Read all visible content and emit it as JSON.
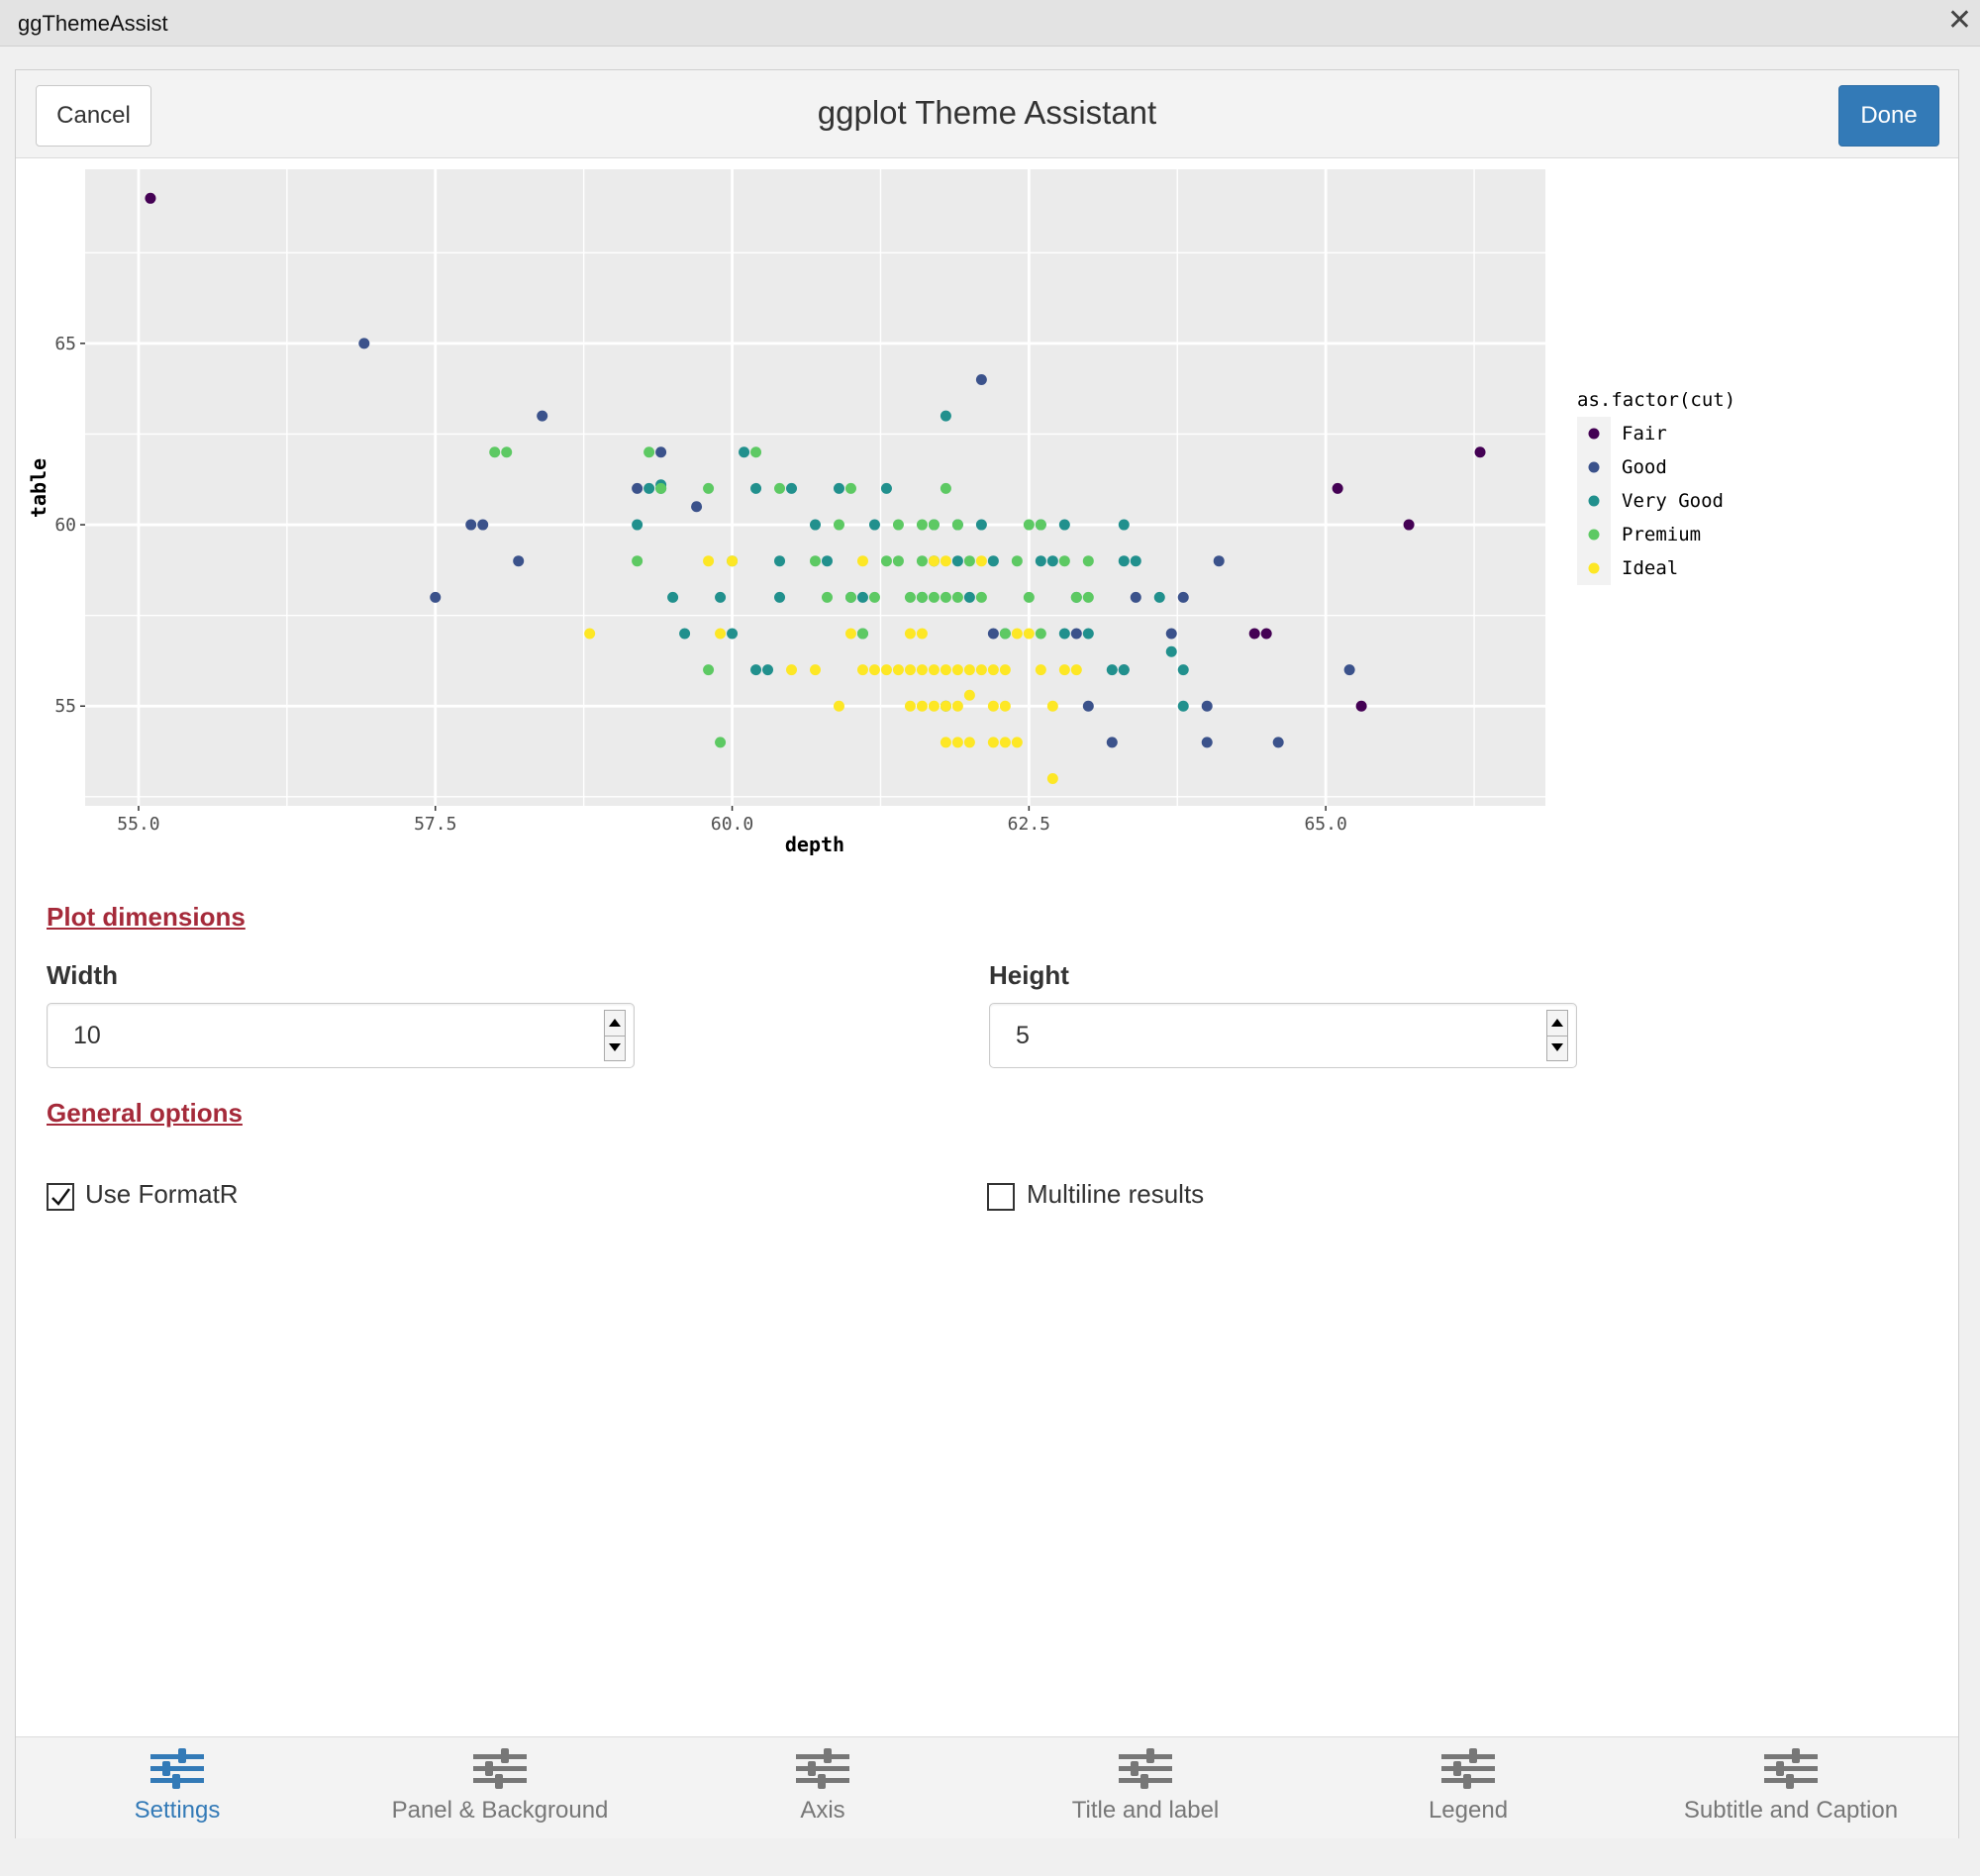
{
  "window": {
    "title": "ggThemeAssist",
    "close_glyph": "✕"
  },
  "header": {
    "cancel_label": "Cancel",
    "title": "ggplot Theme Assistant",
    "done_label": "Done"
  },
  "chart_data": {
    "type": "scatter",
    "xlabel": "depth",
    "ylabel": "table",
    "xlim": [
      54.55,
      66.85
    ],
    "ylim": [
      52.25,
      69.8
    ],
    "x_ticks": [
      55.0,
      57.5,
      60.0,
      62.5,
      65.0
    ],
    "x_tick_labels": [
      "55.0",
      "57.5",
      "60.0",
      "62.5",
      "65.0"
    ],
    "y_ticks": [
      55,
      60,
      65
    ],
    "y_tick_labels": [
      "55",
      "60",
      "65"
    ],
    "panel_background": "#ebebeb",
    "grid": true,
    "legend": {
      "title": "as.factor(cut)",
      "position": "right"
    },
    "series": [
      {
        "name": "Fair",
        "color": "#440154",
        "points": [
          [
            55.1,
            69
          ],
          [
            65.1,
            61
          ],
          [
            65.7,
            60
          ],
          [
            66.3,
            62
          ],
          [
            64.4,
            57
          ],
          [
            64.5,
            57
          ],
          [
            65.3,
            55
          ]
        ]
      },
      {
        "name": "Good",
        "color": "#3b528b",
        "points": [
          [
            56.9,
            65
          ],
          [
            57.5,
            58
          ],
          [
            57.8,
            60
          ],
          [
            57.9,
            60
          ],
          [
            58.2,
            59
          ],
          [
            58.4,
            63
          ],
          [
            59.2,
            61
          ],
          [
            59.4,
            62
          ],
          [
            59.7,
            60.5
          ],
          [
            62.1,
            64
          ],
          [
            63.4,
            58
          ],
          [
            63.0,
            55
          ],
          [
            63.2,
            54
          ],
          [
            63.8,
            58
          ],
          [
            64.1,
            59
          ],
          [
            63.7,
            57
          ],
          [
            64.0,
            55
          ],
          [
            64.0,
            54
          ],
          [
            64.6,
            54
          ],
          [
            65.2,
            56
          ],
          [
            62.9,
            57
          ],
          [
            63.3,
            56
          ],
          [
            62.2,
            57
          ]
        ]
      },
      {
        "name": "Very Good",
        "color": "#21908d",
        "points": [
          [
            59.2,
            60
          ],
          [
            59.3,
            61
          ],
          [
            59.4,
            61
          ],
          [
            59.5,
            58
          ],
          [
            59.6,
            57
          ],
          [
            59.9,
            58
          ],
          [
            60.0,
            57
          ],
          [
            60.1,
            62
          ],
          [
            60.2,
            61
          ],
          [
            60.2,
            56
          ],
          [
            60.3,
            56
          ],
          [
            60.4,
            58
          ],
          [
            60.4,
            59
          ],
          [
            60.5,
            61
          ],
          [
            60.7,
            60
          ],
          [
            60.8,
            59
          ],
          [
            60.9,
            61
          ],
          [
            61.0,
            58
          ],
          [
            61.1,
            57
          ],
          [
            61.1,
            58
          ],
          [
            61.2,
            60
          ],
          [
            61.3,
            61
          ],
          [
            61.6,
            58
          ],
          [
            61.7,
            59
          ],
          [
            61.8,
            63
          ],
          [
            61.9,
            59
          ],
          [
            61.9,
            60
          ],
          [
            62.0,
            58
          ],
          [
            62.1,
            60
          ],
          [
            62.2,
            59
          ],
          [
            62.3,
            57
          ],
          [
            62.6,
            60
          ],
          [
            62.6,
            59
          ],
          [
            62.8,
            60
          ],
          [
            62.8,
            57
          ],
          [
            62.9,
            58
          ],
          [
            63.0,
            57
          ],
          [
            63.2,
            56
          ],
          [
            63.3,
            56
          ],
          [
            63.3,
            60
          ],
          [
            63.3,
            59
          ],
          [
            63.4,
            59
          ],
          [
            63.6,
            58
          ],
          [
            63.7,
            56.5
          ],
          [
            63.8,
            56
          ],
          [
            63.8,
            55
          ],
          [
            61.8,
            55
          ],
          [
            62.7,
            59
          ],
          [
            59.4,
            61.1
          ],
          [
            61.7,
            60
          ]
        ]
      },
      {
        "name": "Premium",
        "color": "#5dc963",
        "points": [
          [
            58.0,
            62
          ],
          [
            58.1,
            62
          ],
          [
            59.2,
            59
          ],
          [
            59.3,
            62
          ],
          [
            59.4,
            61
          ],
          [
            59.8,
            61
          ],
          [
            59.8,
            56
          ],
          [
            59.9,
            54
          ],
          [
            60.0,
            59
          ],
          [
            60.2,
            62
          ],
          [
            60.4,
            61
          ],
          [
            60.8,
            58
          ],
          [
            60.9,
            60
          ],
          [
            61.0,
            58
          ],
          [
            61.0,
            61
          ],
          [
            61.1,
            57
          ],
          [
            61.2,
            58
          ],
          [
            61.3,
            59
          ],
          [
            61.4,
            60
          ],
          [
            61.4,
            59
          ],
          [
            61.5,
            58
          ],
          [
            61.6,
            60
          ],
          [
            61.7,
            58
          ],
          [
            61.8,
            58
          ],
          [
            61.9,
            58
          ],
          [
            61.9,
            60
          ],
          [
            62.0,
            59
          ],
          [
            62.1,
            58
          ],
          [
            62.3,
            57
          ],
          [
            62.4,
            59
          ],
          [
            62.5,
            58
          ],
          [
            62.5,
            60
          ],
          [
            62.6,
            57
          ],
          [
            62.8,
            59
          ],
          [
            62.9,
            58
          ],
          [
            63.0,
            59
          ],
          [
            61.6,
            59
          ],
          [
            61.8,
            61
          ],
          [
            61.7,
            60
          ],
          [
            60.7,
            59
          ],
          [
            62.6,
            60
          ],
          [
            63.0,
            58
          ],
          [
            61.6,
            58
          ]
        ]
      },
      {
        "name": "Ideal",
        "color": "#fde725",
        "points": [
          [
            58.8,
            57
          ],
          [
            59.8,
            59
          ],
          [
            59.9,
            57
          ],
          [
            60.5,
            56
          ],
          [
            60.7,
            56
          ],
          [
            60.9,
            55
          ],
          [
            61.0,
            57
          ],
          [
            61.1,
            59
          ],
          [
            61.2,
            56
          ],
          [
            61.3,
            56
          ],
          [
            61.4,
            56
          ],
          [
            61.5,
            57
          ],
          [
            61.6,
            57
          ],
          [
            61.5,
            55
          ],
          [
            61.6,
            55
          ],
          [
            61.7,
            56
          ],
          [
            61.7,
            55
          ],
          [
            61.8,
            56
          ],
          [
            61.9,
            56
          ],
          [
            61.9,
            55
          ],
          [
            62.0,
            56
          ],
          [
            62.0,
            55.3
          ],
          [
            62.1,
            56
          ],
          [
            62.2,
            56
          ],
          [
            62.2,
            55
          ],
          [
            62.3,
            56
          ],
          [
            62.3,
            55
          ],
          [
            62.4,
            57
          ],
          [
            62.5,
            57
          ],
          [
            62.1,
            59
          ],
          [
            62.2,
            54
          ],
          [
            62.3,
            54
          ],
          [
            62.4,
            54
          ],
          [
            62.0,
            54
          ],
          [
            61.9,
            54
          ],
          [
            62.7,
            53
          ],
          [
            62.7,
            55
          ],
          [
            62.8,
            56
          ],
          [
            62.9,
            56
          ],
          [
            62.6,
            56
          ],
          [
            61.5,
            56
          ],
          [
            61.1,
            56
          ],
          [
            61.8,
            54
          ],
          [
            61.8,
            55
          ],
          [
            61.8,
            59
          ],
          [
            61.7,
            59
          ],
          [
            60.0,
            59
          ],
          [
            61.6,
            56
          ]
        ]
      }
    ]
  },
  "plot_dimensions": {
    "section_title": "Plot dimensions",
    "width_label": "Width",
    "width_value": "10",
    "height_label": "Height",
    "height_value": "5"
  },
  "general_options": {
    "section_title": "General options",
    "use_formatr_label": "Use FormatR",
    "use_formatr_checked": true,
    "multiline_label": "Multiline results",
    "multiline_checked": false
  },
  "tabs": [
    {
      "label": "Settings",
      "icon": "sliders-icon",
      "active": true
    },
    {
      "label": "Panel & Background",
      "icon": "sliders-icon",
      "active": false
    },
    {
      "label": "Axis",
      "icon": "sliders-icon",
      "active": false
    },
    {
      "label": "Title and label",
      "icon": "sliders-icon",
      "active": false
    },
    {
      "label": "Legend",
      "icon": "sliders-icon",
      "active": false
    },
    {
      "label": "Subtitle and Caption",
      "icon": "sliders-icon",
      "active": false
    }
  ],
  "colors": {
    "accent": "#337ab7",
    "section_title": "#a52a3a",
    "inactive_tab": "#777777"
  }
}
